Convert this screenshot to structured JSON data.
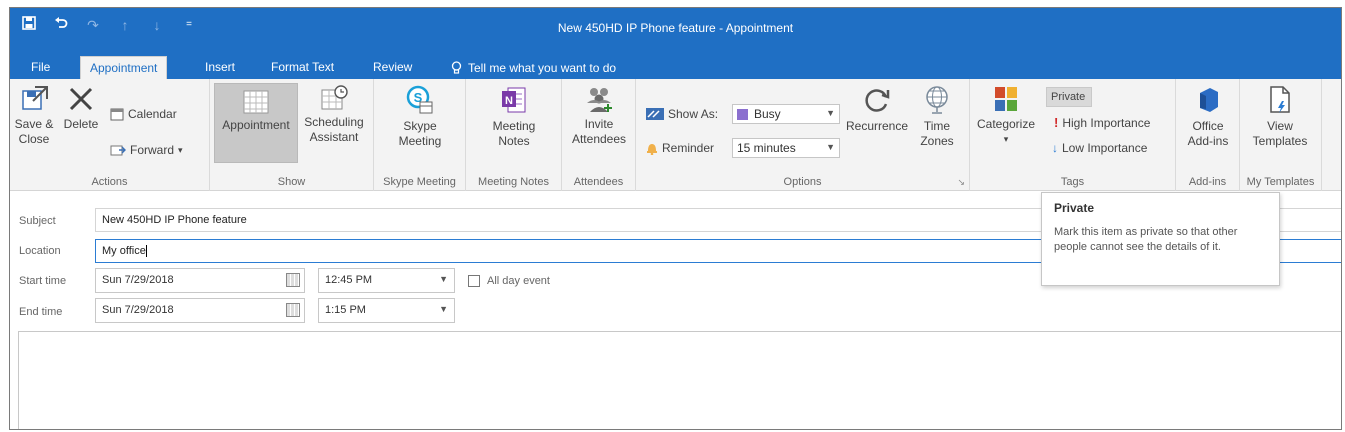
{
  "window": {
    "title": "New 450HD IP Phone feature  -  Appointment"
  },
  "qat": {
    "save_icon": "save-icon",
    "undo_icon": "undo-icon",
    "redo_icon": "redo-icon",
    "up_icon": "up-arrow-icon",
    "down_icon": "down-arrow-icon",
    "customize_icon": "customize-icon"
  },
  "tabs": {
    "file": "File",
    "appointment": "Appointment",
    "insert": "Insert",
    "format_text": "Format Text",
    "review": "Review",
    "tell_me": "Tell me what you want to do"
  },
  "ribbon": {
    "actions": {
      "label": "Actions",
      "save_close": "Save & Close",
      "delete": "Delete",
      "calendar": "Calendar",
      "forward": "Forward"
    },
    "show": {
      "label": "Show",
      "appointment": "Appointment",
      "scheduling_assistant": "Scheduling Assistant"
    },
    "skype": {
      "label": "Skype Meeting",
      "skype_meeting": "Skype Meeting"
    },
    "meeting_notes": {
      "label": "Meeting Notes",
      "meeting_notes": "Meeting Notes"
    },
    "attendees": {
      "label": "Attendees",
      "invite_attendees": "Invite Attendees"
    },
    "options": {
      "label": "Options",
      "show_as_label": "Show As:",
      "show_as_value": "Busy",
      "reminder_label": "Reminder",
      "reminder_value": "15 minutes",
      "recurrence": "Recurrence",
      "time_zones": "Time Zones"
    },
    "tags": {
      "label": "Tags",
      "categorize": "Categorize",
      "private": "Private",
      "high_importance": "High Importance",
      "low_importance": "Low Importance"
    },
    "addins": {
      "label": "Add-ins",
      "office_addins": "Office Add-ins"
    },
    "templates": {
      "label": "My Templates",
      "view_templates": "View Templates"
    }
  },
  "form": {
    "subject_label": "Subject",
    "subject_value": "New 450HD IP Phone feature",
    "location_label": "Location",
    "location_value": "My office",
    "start_label": "Start time",
    "start_date": "Sun 7/29/2018",
    "start_time": "12:45 PM",
    "all_day_label": "All day event",
    "end_label": "End time",
    "end_date": "Sun 7/29/2018",
    "end_time": "1:15 PM"
  },
  "tooltip": {
    "title": "Private",
    "description": "Mark this item as private so that other people cannot see the details of it."
  },
  "colors": {
    "accent": "#1f6fc4",
    "busy": "#8b6fcf",
    "ribbon_bg": "#f3f3f3"
  }
}
